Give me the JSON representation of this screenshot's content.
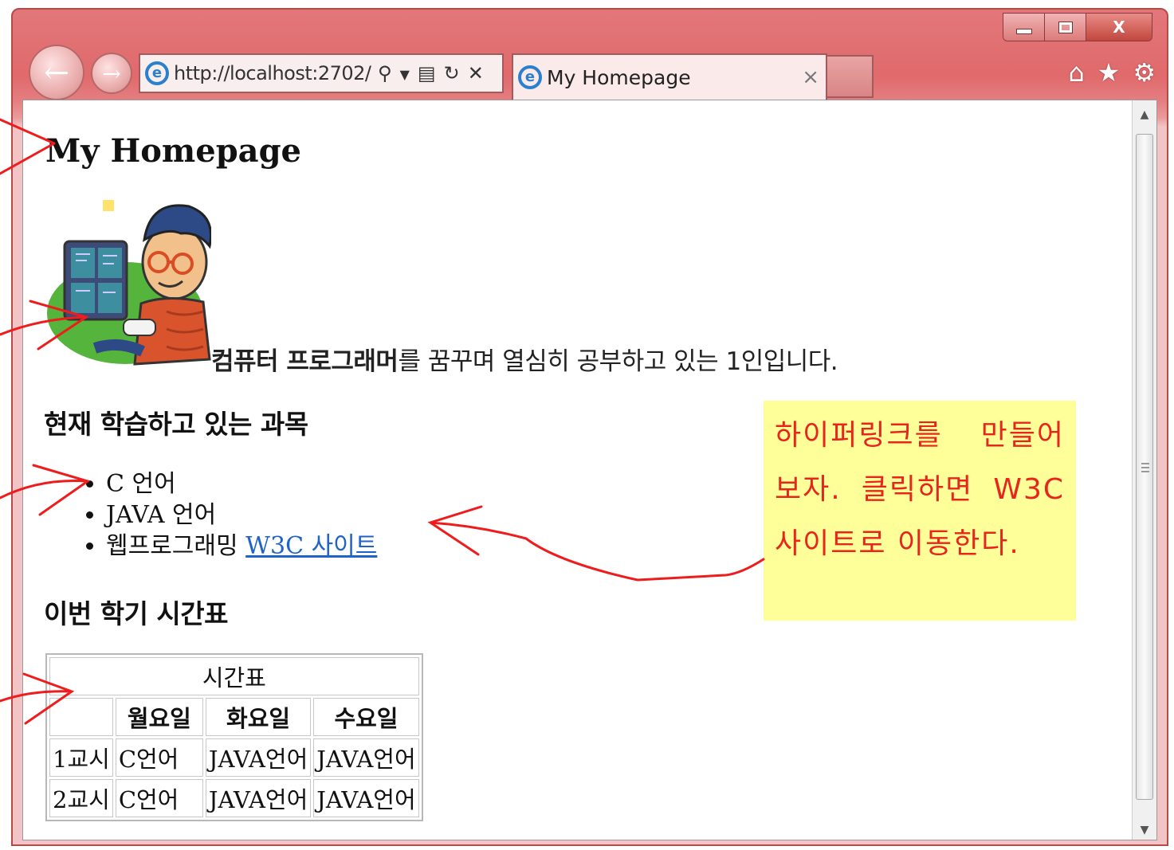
{
  "browser": {
    "url": "http://localhost:2702/",
    "tab_title": "My Homepage",
    "tab_close": "×",
    "window_close": "X"
  },
  "page": {
    "heading": "My Homepage",
    "intro_bold": "컴퓨터 프로그래머",
    "intro_rest": "를 꿈꾸며 열심히 공부하고 있는 1인입니다.",
    "subjects_heading": "현재 학습하고 있는 과목",
    "subjects": [
      "C 언어",
      "JAVA 언어",
      "웹프로그래밍"
    ],
    "link_text": "W3C 사이트",
    "schedule_heading": "이번 학기 시간표",
    "table": {
      "caption": "시간표",
      "headers": [
        "",
        "월요일",
        "화요일",
        "수요일"
      ],
      "rows": [
        [
          "1교시",
          "C언어",
          "JAVA언어",
          "JAVA언어"
        ],
        [
          "2교시",
          "C언어",
          "JAVA언어",
          "JAVA언어"
        ]
      ]
    }
  },
  "annotation": {
    "callout": "하이퍼링크를 만들어보자. 클릭하면 W3C 사이트로 이동한다."
  },
  "icons": {
    "back": "back-arrow-icon",
    "forward": "forward-arrow-icon",
    "home": "home-icon",
    "favorites": "star-icon",
    "settings": "gear-icon"
  },
  "colors": {
    "chrome": "#e06a6c",
    "link": "#1f63c6",
    "callout_bg": "#ffff99",
    "annotation": "#e8251c"
  }
}
